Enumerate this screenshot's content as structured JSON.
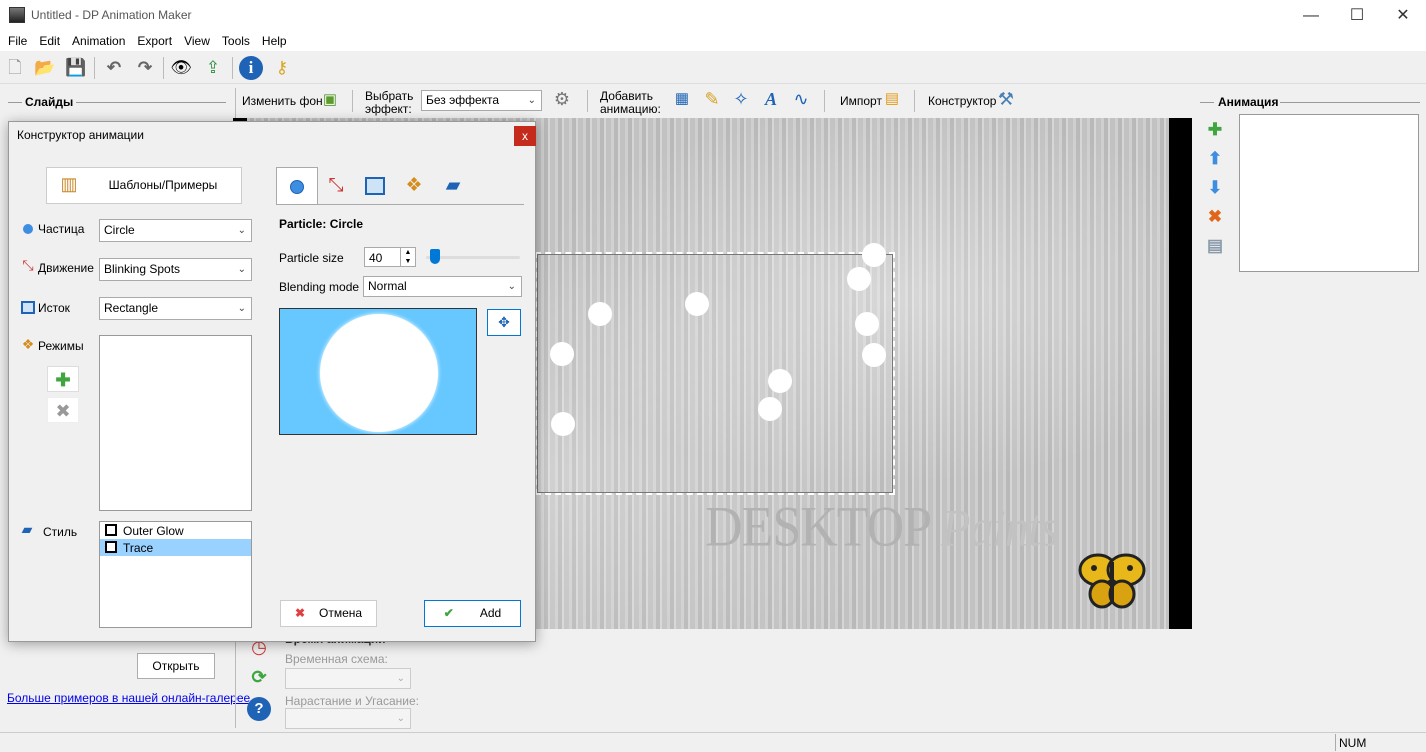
{
  "window": {
    "title": "Untitled - DP Animation Maker",
    "minimize": "—",
    "maximize": "☐",
    "close": "✕"
  },
  "menu": [
    "File",
    "Edit",
    "Animation",
    "Export",
    "View",
    "Tools",
    "Help"
  ],
  "toolbar_icons": [
    "new-icon",
    "open-icon",
    "save-icon",
    "undo-icon",
    "redo-icon",
    "preview-icon",
    "export-icon",
    "info-icon",
    "key-icon"
  ],
  "slides": {
    "title": "Слайды",
    "open_button": "Открыть",
    "gallery_link": "Больше примеров в нашей онлайн-галерее"
  },
  "effects_bar": {
    "change_bg": "Изменить фон",
    "choose_effect_1": "Выбрать",
    "choose_effect_2": "эффект:",
    "effect_value": "Без эффекта",
    "add_anim_1": "Добавить",
    "add_anim_2": "анимацию:",
    "import": "Импорт",
    "constructor": "Конструктор"
  },
  "animation_panel": {
    "title": "Анимация"
  },
  "bottom": {
    "anim_time_heading": "Время анимации",
    "time_scheme_label": "Временная схема:",
    "fade_label": "Нарастание и Угасание:"
  },
  "watermark": {
    "text1": "DESKTOP",
    "text2": "Paints"
  },
  "dialog": {
    "title": "Конструктор анимации",
    "close": "x",
    "templates_button": "Шаблоны/Примеры",
    "particle_label": "Частица",
    "particle_value": "Circle",
    "motion_label": "Движение",
    "motion_value": "Blinking Spots",
    "source_label": "Исток",
    "source_value": "Rectangle",
    "modes_label": "Режимы",
    "style_label": "Стиль",
    "styles": [
      {
        "label": "Outer Glow",
        "selected": false
      },
      {
        "label": "Trace",
        "selected": true
      }
    ],
    "section_title": "Particle: Circle",
    "size_label": "Particle size",
    "size_value": "40",
    "size_slider_fraction": 0.1,
    "blend_label": "Blending mode",
    "blend_value": "Normal",
    "cancel_button": "Отмена",
    "add_button": "Add"
  },
  "status": {
    "num": "NUM"
  },
  "colors": {
    "accent": "#0078d7",
    "preview_bg": "#66c8ff",
    "selected_row": "#99d1ff",
    "close_red": "#c42b1c"
  }
}
